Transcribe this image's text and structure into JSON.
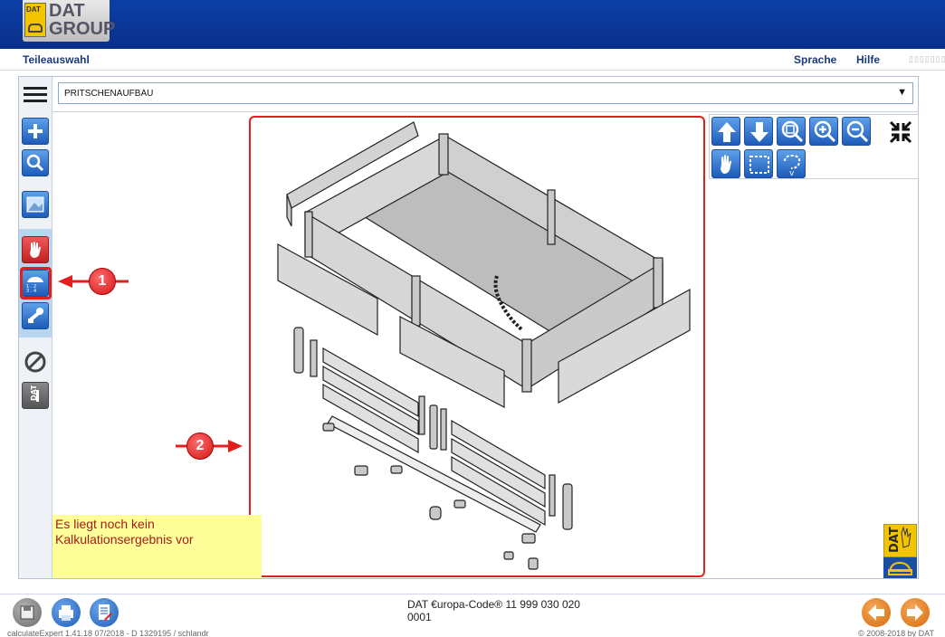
{
  "header": {
    "logo_top": "DAT",
    "logo_bottom": "GROUP",
    "logo_badge": "DAT"
  },
  "menubar": {
    "title": "Teileauswahl",
    "language": "Sprache",
    "help": "Hilfe"
  },
  "dropdown": {
    "value": "PRITSCHENAUFBAU"
  },
  "note": {
    "line1": "Es liegt noch kein",
    "line2": "Kalkulationsergebnis vor"
  },
  "callouts": {
    "one": "1",
    "two": "2"
  },
  "footer": {
    "code_line1": "DAT €uropa-Code® 11 999 030 020",
    "code_line2": "0001",
    "status": "calculateExpert   1.41.18   07/2018 - D   1329195 / schlandr",
    "copyright": "© 2008-2018 by DAT"
  },
  "colors": {
    "header_blue": "#0b3fa6",
    "accent_red": "#e0201e",
    "button_blue": "#1d5bb9",
    "note_yellow": "#ffff99",
    "nav_orange": "#e8801c"
  },
  "icons": {
    "sidebar": [
      "menu-icon",
      "plus-icon",
      "search-icon",
      "image-icon",
      "hand-icon",
      "vehicle-grid-icon",
      "wrench-icon",
      "forbidden-icon",
      "dat-tool-icon"
    ],
    "toolbar": [
      "arrow-up-icon",
      "arrow-down-icon",
      "zoom-fit-icon",
      "zoom-in-icon",
      "zoom-out-icon",
      "collapse-icon",
      "pan-hand-icon",
      "rect-select-icon",
      "lasso-select-icon"
    ],
    "footer": [
      "save-icon",
      "print-icon",
      "report-icon",
      "back-icon",
      "forward-icon"
    ]
  }
}
